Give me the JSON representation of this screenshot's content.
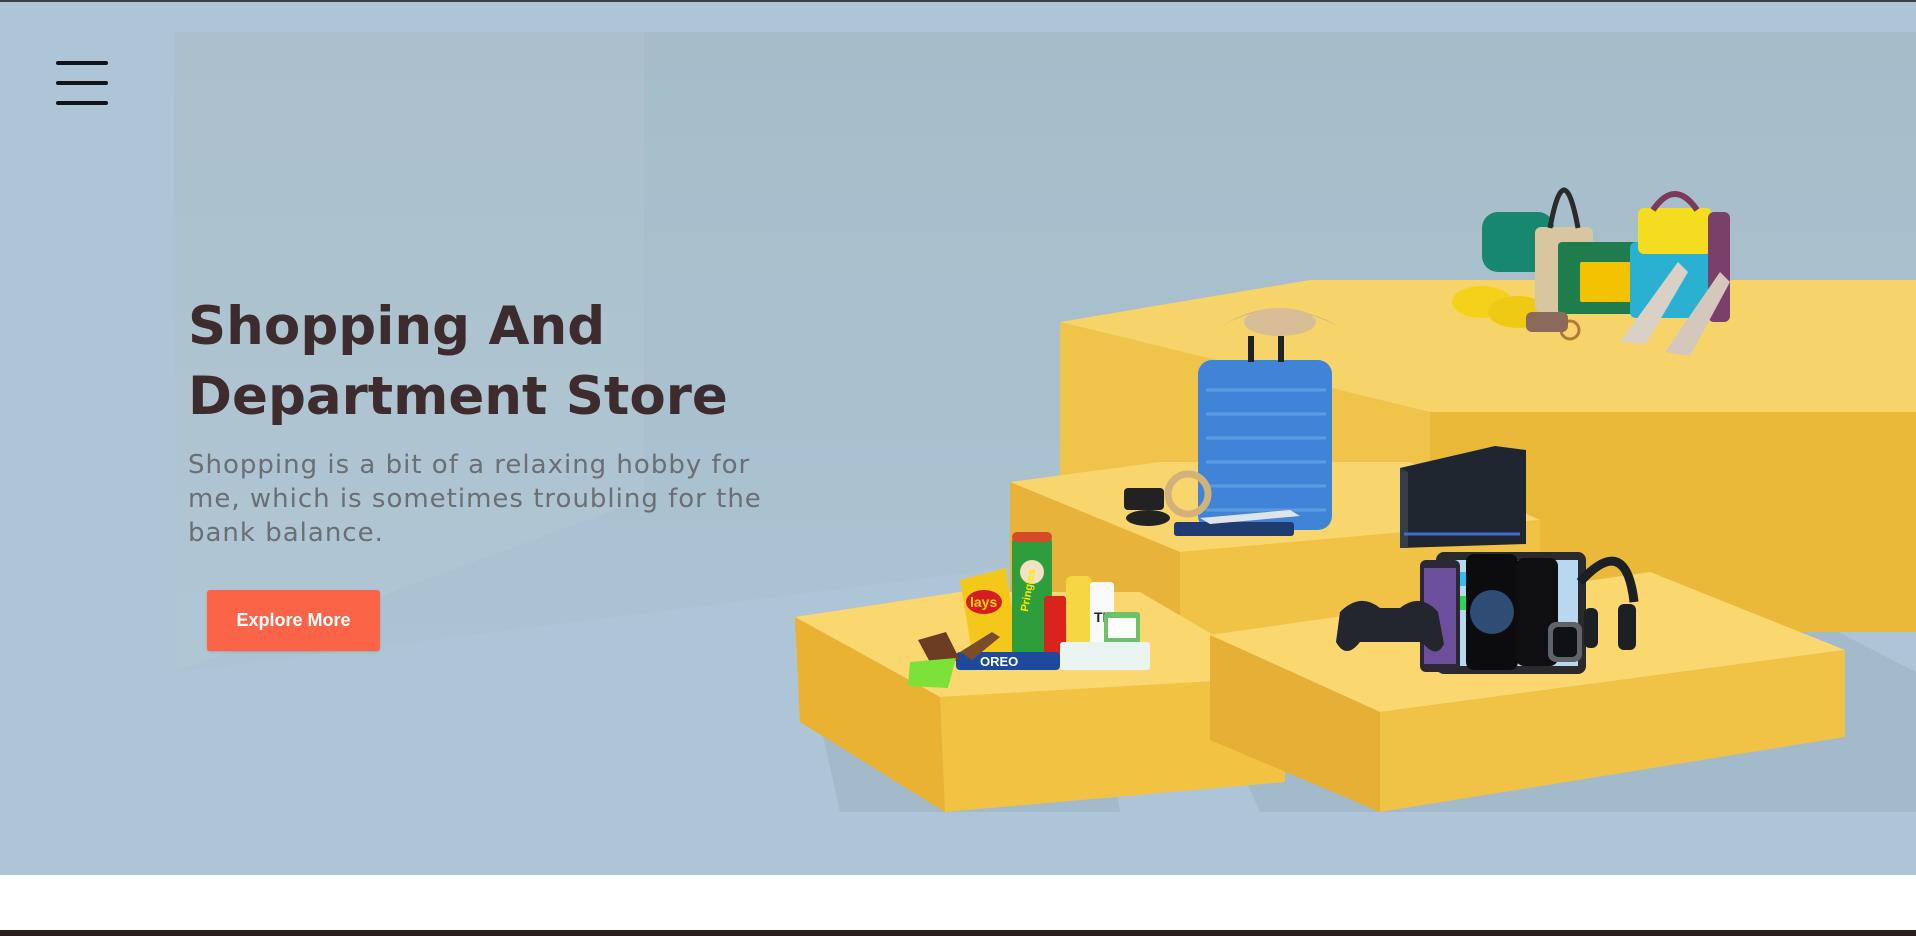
{
  "hero": {
    "title_line1": "Shopping And",
    "title_line2": "Department Store",
    "description": "Shopping is a bit of a relaxing hobby for me, which is sometimes troubling for the bank balance.",
    "cta_label": "Explore More"
  },
  "menu": {
    "icon": "hamburger-menu-icon"
  },
  "illustration": {
    "product_labels": {
      "chips": "lays",
      "tube": "Pringles",
      "bottle": "TEA",
      "cookies": "OREO"
    }
  },
  "colors": {
    "hero_bg": "#adc5d6",
    "title": "#3d2b2d",
    "text": "#6b6f74",
    "cta": "#fc6447",
    "platform": "#f2c14e"
  }
}
